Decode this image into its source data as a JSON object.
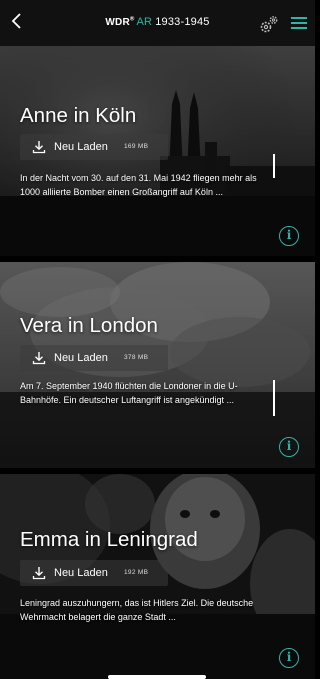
{
  "header": {
    "brand": "WDR",
    "brand_mark": "®",
    "ar": "AR",
    "years": "1933-1945",
    "accent_color": "#2fb4a8"
  },
  "stories": [
    {
      "title": "Anne in Köln",
      "download_label": "Neu Laden",
      "size": "169 MB",
      "teaser": "In der Nacht vom 30. auf den 31. Mai 1942 fliegen mehr als 1000 alliierte Bomber einen Großangriff auf Köln ..."
    },
    {
      "title": "Vera in London",
      "download_label": "Neu Laden",
      "size": "378 MB",
      "teaser": "Am 7. September 1940 flüchten die Londoner in die U-Bahnhöfe. Ein deutscher Luftangriff ist angekündigt ..."
    },
    {
      "title": "Emma in Leningrad",
      "download_label": "Neu Laden",
      "size": "192 MB",
      "teaser": "Leningrad auszuhungern, das ist Hitlers Ziel. Die deutsche Wehrmacht belagert die ganze Stadt ..."
    }
  ],
  "icons": {
    "back": "chevron-left-icon",
    "settings": "gears-icon",
    "menu": "hamburger-menu-icon",
    "download": "download-icon",
    "info": "info-icon"
  }
}
